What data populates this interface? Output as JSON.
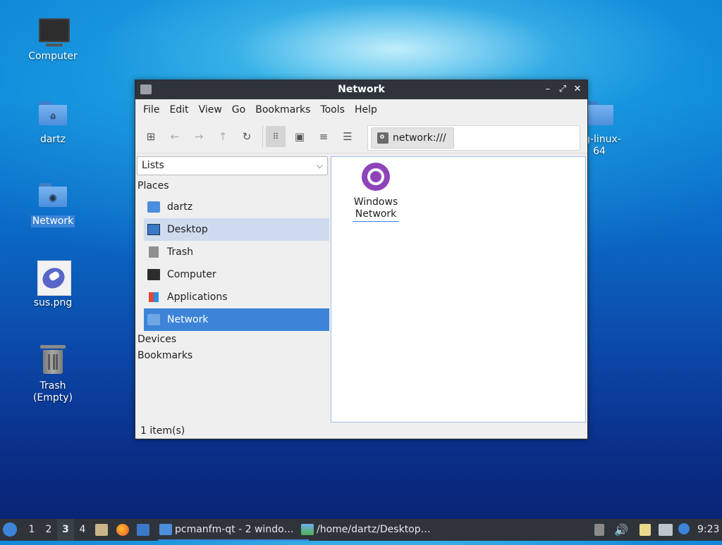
{
  "desktop": {
    "icons": [
      {
        "label": "Computer"
      },
      {
        "label": "dartz"
      },
      {
        "label": "Network"
      },
      {
        "label": "sus.png"
      },
      {
        "label": "Trash (Empty)"
      },
      {
        "label": "ng-linux-\n64"
      }
    ]
  },
  "window": {
    "title": "Network",
    "menu": [
      "File",
      "Edit",
      "View",
      "Go",
      "Bookmarks",
      "Tools",
      "Help"
    ],
    "path": "network:///",
    "side_view_selector": "Lists",
    "sections": {
      "places": "Places",
      "devices": "Devices",
      "bookmarks": "Bookmarks"
    },
    "places": [
      {
        "label": "dartz",
        "icon": "home-folder-icon"
      },
      {
        "label": "Desktop",
        "icon": "desktop-icon"
      },
      {
        "label": "Trash",
        "icon": "trash-icon"
      },
      {
        "label": "Computer",
        "icon": "computer-icon"
      },
      {
        "label": "Applications",
        "icon": "applications-icon"
      },
      {
        "label": "Network",
        "icon": "network-icon"
      }
    ],
    "items": [
      {
        "label_line1": "Windows",
        "label_line2": "Network",
        "icon": "network-globe-icon"
      }
    ],
    "status": "1 item(s)"
  },
  "taskbar": {
    "workspaces": [
      "1",
      "2",
      "3",
      "4"
    ],
    "current_workspace": "3",
    "tasks": [
      {
        "label": "pcmanfm-qt - 2 windo…"
      },
      {
        "label": "/home/dartz/Desktop…"
      }
    ],
    "clock": "9:23"
  },
  "colors": {
    "accent": "#3d84d8",
    "titlebar": "#2f343b",
    "globe": "#8e44b8"
  }
}
